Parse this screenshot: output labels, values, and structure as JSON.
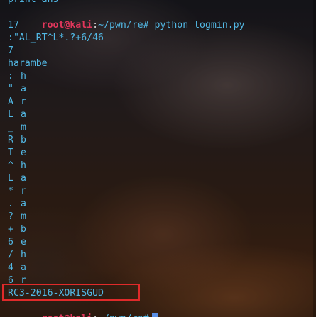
{
  "terminal": {
    "top_partial": "print ans",
    "prompt": {
      "user_host": "root@kali",
      "separator": ":",
      "path": "~/pwn/re",
      "symbol": "#"
    },
    "command": "python logmin.py",
    "outputs": [
      "17",
      ":\"AL_RT^L*.?+6/46",
      "7",
      "harambe"
    ],
    "zip_pairs": [
      [
        ":",
        "h"
      ],
      [
        "\"",
        "a"
      ],
      [
        "A",
        "r"
      ],
      [
        "L",
        "a"
      ],
      [
        "_",
        "m"
      ],
      [
        "R",
        "b"
      ],
      [
        "T",
        "e"
      ],
      [
        "^",
        "h"
      ],
      [
        "L",
        "a"
      ],
      [
        "*",
        "r"
      ],
      [
        ".",
        "a"
      ],
      [
        "?",
        "m"
      ],
      [
        "+",
        "b"
      ],
      [
        "6",
        "e"
      ],
      [
        "/",
        "h"
      ],
      [
        "4",
        "a"
      ],
      [
        "6",
        "r"
      ]
    ],
    "flag": "RC3-2016-XORISGUD"
  },
  "colors": {
    "text": "#52b8e4",
    "prompt_user": "#e0365b",
    "highlight_border": "#e02a2a",
    "cursor": "#5a8fe6"
  }
}
